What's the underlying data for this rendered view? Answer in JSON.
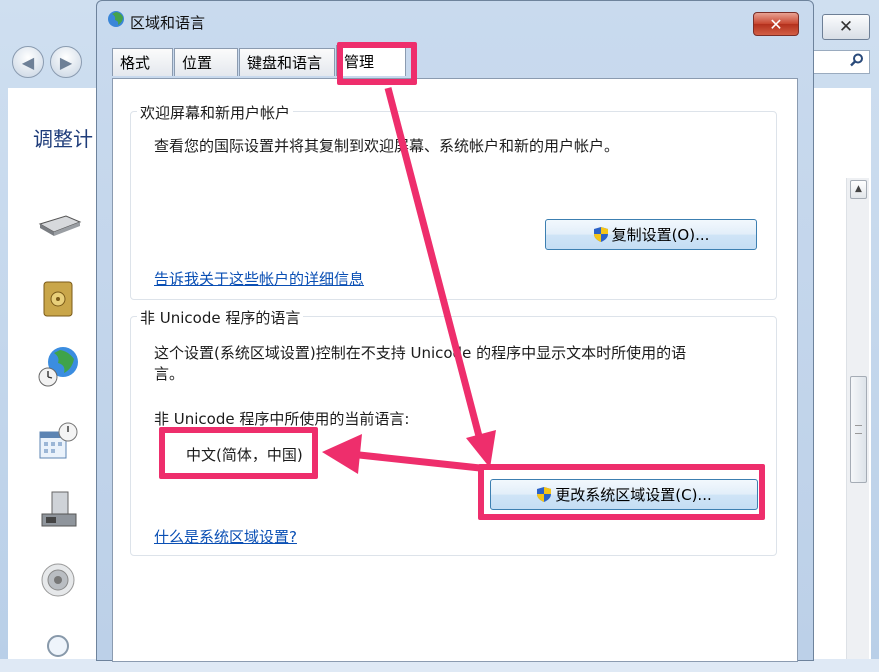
{
  "background_window": {
    "title_partial": "调整计",
    "close_glyph": "✕",
    "back_glyph": "◀",
    "forward_glyph": "▶",
    "search_icon": "search-icon"
  },
  "dialog": {
    "title": "区域和语言",
    "close_glyph": "✕",
    "tabs": [
      {
        "label": "格式"
      },
      {
        "label": "位置"
      },
      {
        "label": "键盘和语言"
      },
      {
        "label": "管理",
        "active": true
      }
    ],
    "welcome_group": {
      "legend": "欢迎屏幕和新用户帐户",
      "description": "查看您的国际设置并将其复制到欢迎屏幕、系统帐户和新的用户帐户。",
      "copy_button": "复制设置(O)...",
      "link": "告诉我关于这些帐户的详细信息"
    },
    "unicode_group": {
      "legend": "非 Unicode 程序的语言",
      "description_line1": "这个设置(系统区域设置)控制在不支持 Unicode 的程序中显示文本时所使用的语",
      "description_line2": "言。",
      "current_label": "非 Unicode 程序中所使用的当前语言:",
      "current_value": "中文(简体，中国)",
      "change_button": "更改系统区域设置(C)...",
      "link": "什么是系统区域设置?"
    }
  },
  "watermark": "",
  "colors": {
    "highlight": "#ee2e6c",
    "link": "#0a4fb4",
    "dialog_frame": "#c9daee"
  }
}
